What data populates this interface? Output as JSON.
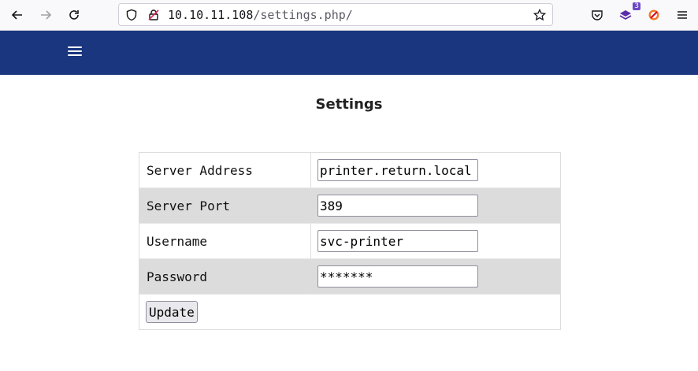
{
  "browser": {
    "url_host": "10.10.11.108",
    "url_path": "/settings.php/",
    "extension_badge": "3"
  },
  "page": {
    "title": "Settings"
  },
  "form": {
    "fields": [
      {
        "label": "Server Address",
        "value": "printer.return.local"
      },
      {
        "label": "Server Port",
        "value": "389"
      },
      {
        "label": "Username",
        "value": "svc-printer"
      },
      {
        "label": "Password",
        "value": "*******"
      }
    ],
    "submit_label": "Update"
  }
}
